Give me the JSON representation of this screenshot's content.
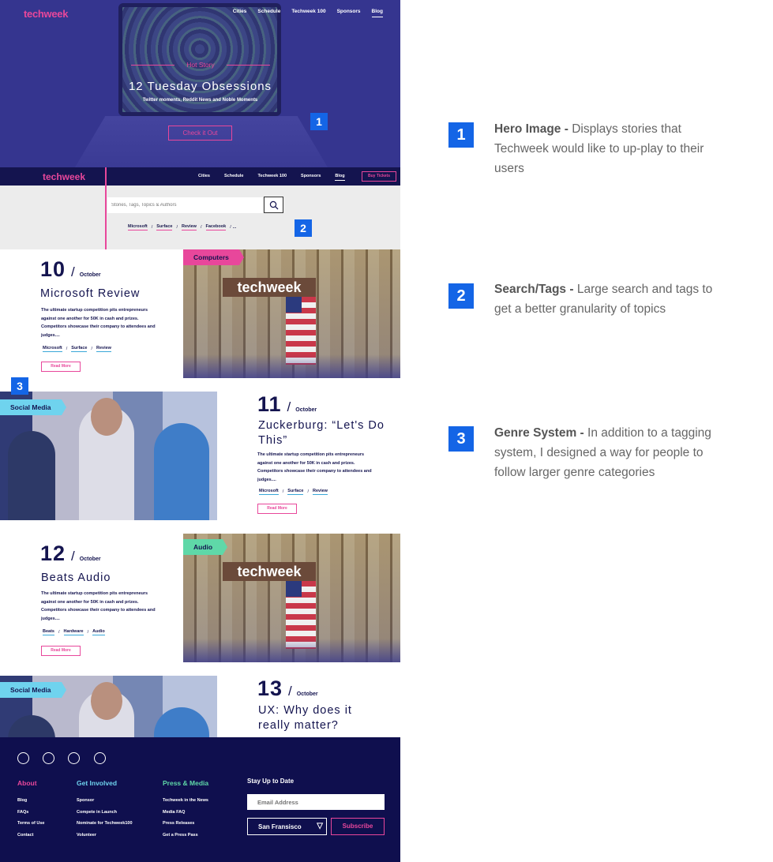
{
  "hero": {
    "logo": "techweek",
    "nav": [
      "Cities",
      "Schedule",
      "Techweek 100",
      "Sponsors",
      "Blog"
    ],
    "kicker": "Hot Story",
    "title": "12 Tuesday Obsessions",
    "subtitle": "Twitter moments, Reddit News and Noble Moments",
    "cta": "Check it Out",
    "marker": "1"
  },
  "nav2": {
    "logo": "techweek",
    "links": [
      "Cities",
      "Schedule",
      "Techweek 100",
      "Sponsors",
      "Blog"
    ],
    "buy": "Buy Tickets"
  },
  "search": {
    "placeholder": "Stories, Tags, Topics & Authors",
    "tags": [
      "Microsoft",
      "Surface",
      "Review",
      "Facebook",
      "..."
    ],
    "marker": "2"
  },
  "articles": [
    {
      "day": "10",
      "month": "October",
      "title": "Microsoft Review",
      "body": "The ultimate startup competition pits entrepreneurs against one another for 50K in cash and prizes. Competitors showcase their company to attendees and judges....",
      "tags": [
        "Microsoft",
        "Surface",
        "Review"
      ],
      "genre": "Computers",
      "genre_color": "#e8479b",
      "read_more": "Read More"
    },
    {
      "day": "11",
      "month": "October",
      "title": "Zuckerburg: “Let's Do This”",
      "body": "The ultimate startup competition pits entrepreneurs against one another for 50K in cash and prizes. Competitors showcase their company to attendees and judges....",
      "tags": [
        "Microsoft",
        "Surface",
        "Review"
      ],
      "genre": "Social Media",
      "genre_color": "#6fd3ee",
      "read_more": "Read More",
      "marker": "3"
    },
    {
      "day": "12",
      "month": "October",
      "title": "Beats Audio",
      "body": "The ultimate startup competition pits entrepreneurs against one another for 50K in cash and prizes. Competitors showcase their company to attendees and judges....",
      "tags": [
        "Beats",
        "Hardware",
        "Audio"
      ],
      "genre": "Audio",
      "genre_color": "#5fd8a8",
      "read_more": "Read More"
    },
    {
      "day": "13",
      "month": "October",
      "title": "UX: Why does it really matter?",
      "genre": "Social Media",
      "genre_color": "#6fd3ee"
    }
  ],
  "footer": {
    "columns": [
      {
        "heading": "About",
        "color": "#e8479b",
        "items": [
          "Blog",
          "FAQs",
          "Terms of Use",
          "Contact"
        ]
      },
      {
        "heading": "Get Involved",
        "color": "#6fd3ee",
        "items": [
          "Sponsor",
          "Compete in Launch",
          "Nominate for Techweek100",
          "Volunteer"
        ]
      },
      {
        "heading": "Press & Media",
        "color": "#5fd8a8",
        "items": [
          "Techweek in the News",
          "Media FAQ",
          "Press Releases",
          "Get a Press Pass"
        ]
      }
    ],
    "stay_title": "Stay Up to Date",
    "email_placeholder": "Email Address",
    "city": "San Fransisco",
    "subscribe": "Subscribe"
  },
  "annotations": [
    {
      "number": "1",
      "label": "Hero Image -",
      "text": "Displays stories that Techweek would like to up-play to their users"
    },
    {
      "number": "2",
      "label": "Search/Tags -",
      "text": "Large search and tags to get a better granularity of topics"
    },
    {
      "number": "3",
      "label": "Genre System -",
      "text": "In addition to a tagging system, I designed a way for people to follow larger genre categories"
    }
  ]
}
